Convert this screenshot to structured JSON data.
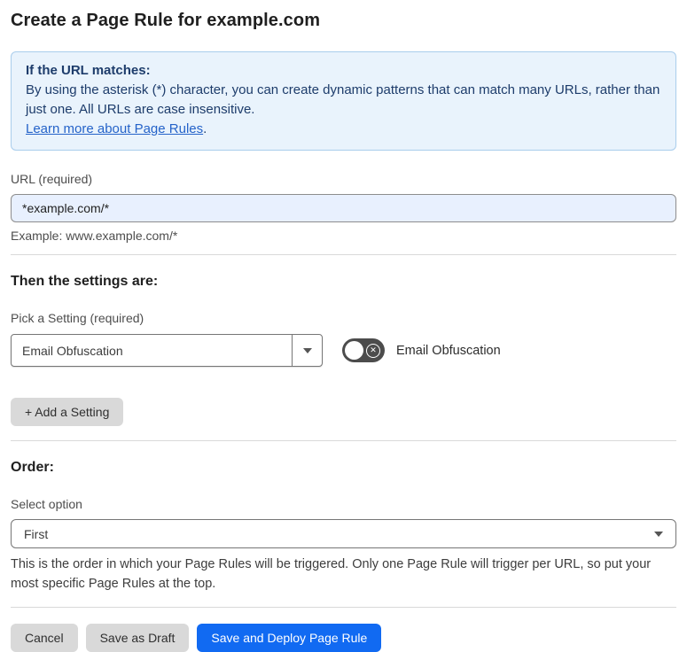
{
  "page": {
    "title": "Create a Page Rule for example.com"
  },
  "info_box": {
    "heading": "If the URL matches:",
    "body": "By using the asterisk (*) character, you can create dynamic patterns that can match many URLs, rather than just one. All URLs are case insensitive.",
    "link_label": "Learn more about Page Rules",
    "link_suffix": "."
  },
  "url_field": {
    "label": "URL (required)",
    "value": "*example.com/*",
    "example": "Example: www.example.com/*"
  },
  "settings_section": {
    "heading": "Then the settings are:",
    "picker_label": "Pick a Setting (required)",
    "picker_value": "Email Obfuscation",
    "toggle_label": "Email Obfuscation",
    "toggle_state": "off",
    "add_button_label": "+ Add a Setting"
  },
  "order_section": {
    "heading": "Order:",
    "select_label": "Select option",
    "select_value": "First",
    "help_text": "This is the order in which your Page Rules will be triggered. Only one Page Rule will trigger per URL, so put your most specific Page Rules at the top."
  },
  "footer": {
    "cancel_label": "Cancel",
    "save_draft_label": "Save as Draft",
    "save_deploy_label": "Save and Deploy Page Rule"
  },
  "colors": {
    "accent_blue": "#116af2",
    "info_bg": "#e9f3fc",
    "info_border": "#a9cdec",
    "info_text": "#1d3c6b",
    "link_blue": "#2563c9",
    "input_bg": "#e8f0fe",
    "toggle_bg": "#4c4c4c",
    "btn_gray": "#d9d9d9",
    "divider": "#d9d9d9"
  }
}
